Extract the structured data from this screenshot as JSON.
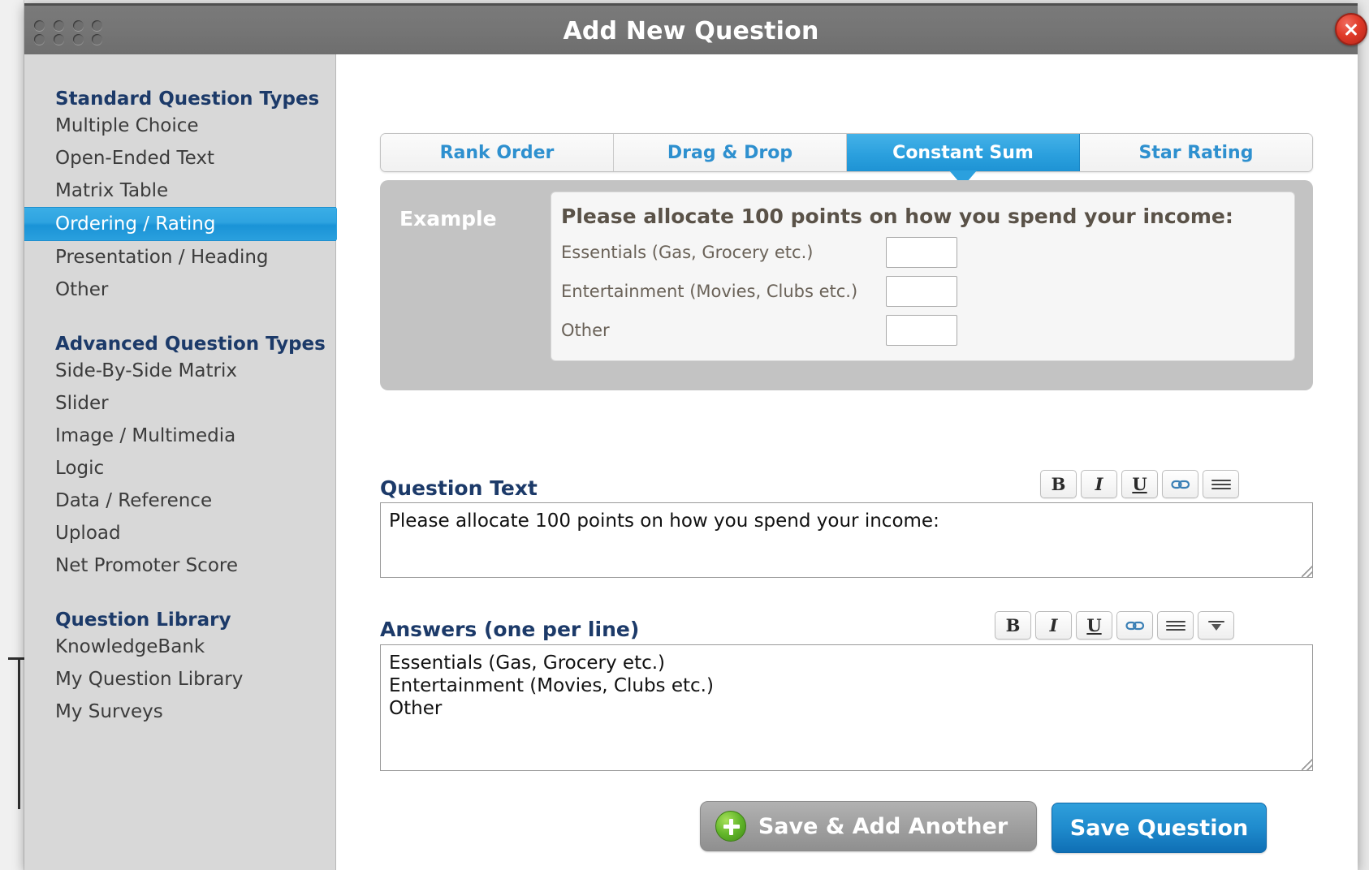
{
  "window": {
    "title": "Add New Question",
    "grip_icon": "drag-grip-dots",
    "close_icon": "close-icon"
  },
  "sidebar": {
    "sections": [
      {
        "title": "Standard Question Types",
        "items": [
          {
            "label": "Multiple Choice",
            "selected": false
          },
          {
            "label": "Open-Ended Text",
            "selected": false
          },
          {
            "label": "Matrix Table",
            "selected": false
          },
          {
            "label": "Ordering / Rating",
            "selected": true
          },
          {
            "label": "Presentation / Heading",
            "selected": false
          },
          {
            "label": "Other",
            "selected": false
          }
        ]
      },
      {
        "title": "Advanced Question Types",
        "items": [
          {
            "label": "Side-By-Side Matrix",
            "selected": false
          },
          {
            "label": "Slider",
            "selected": false
          },
          {
            "label": "Image / Multimedia",
            "selected": false
          },
          {
            "label": "Logic",
            "selected": false
          },
          {
            "label": "Data / Reference",
            "selected": false
          },
          {
            "label": "Upload",
            "selected": false
          },
          {
            "label": "Net Promoter Score",
            "selected": false
          }
        ]
      },
      {
        "title": "Question Library",
        "items": [
          {
            "label": "KnowledgeBank",
            "selected": false
          },
          {
            "label": "My Question Library",
            "selected": false
          },
          {
            "label": "My Surveys",
            "selected": false
          }
        ]
      }
    ]
  },
  "main": {
    "tabs": [
      {
        "label": "Rank Order",
        "active": false
      },
      {
        "label": "Drag & Drop",
        "active": false
      },
      {
        "label": "Constant Sum",
        "active": true
      },
      {
        "label": "Star Rating",
        "active": false
      }
    ],
    "example": {
      "label": "Example",
      "question": "Please allocate 100 points on how you spend your income:",
      "rows": [
        {
          "label": "Essentials (Gas, Grocery etc.)",
          "value": ""
        },
        {
          "label": "Entertainment (Movies, Clubs etc.)",
          "value": ""
        },
        {
          "label": "Other",
          "value": ""
        }
      ]
    },
    "question_text": {
      "label": "Question Text",
      "value": "Please allocate 100 points on how you spend your income:",
      "toolbar": [
        {
          "icon": "bold-icon",
          "glyph": "B",
          "style": "b"
        },
        {
          "icon": "italic-icon",
          "glyph": "I",
          "style": "i"
        },
        {
          "icon": "underline-icon",
          "glyph": "U",
          "style": "u"
        },
        {
          "icon": "link-icon",
          "glyph": "ὑ7",
          "style": "link"
        },
        {
          "icon": "align-lines-icon",
          "glyph": "≡",
          "style": "lines"
        }
      ]
    },
    "answers": {
      "label": "Answers (one per line)",
      "value": "Essentials (Gas, Grocery etc.)\nEntertainment (Movies, Clubs etc.)\nOther",
      "toolbar": [
        {
          "icon": "bold-icon",
          "glyph": "B",
          "style": "b"
        },
        {
          "icon": "italic-icon",
          "glyph": "I",
          "style": "i"
        },
        {
          "icon": "underline-icon",
          "glyph": "U",
          "style": "u"
        },
        {
          "icon": "link-icon",
          "glyph": "ὑ7",
          "style": "link"
        },
        {
          "icon": "align-lines-icon",
          "glyph": "≡",
          "style": "lines"
        },
        {
          "icon": "chevron-down-icon",
          "glyph": "▼",
          "style": "dropdown"
        }
      ]
    },
    "buttons": {
      "save_add_another": "Save & Add Another",
      "save_add_another_icon": "plus-circle-icon",
      "save_question": "Save Question"
    }
  },
  "colors": {
    "accent_blue": "#2ba0de",
    "heading_navy": "#1c3a69",
    "titlebar_gray": "#757575",
    "close_red": "#e03a28",
    "plus_green": "#62b62a",
    "save_blue": "#1f8bcd"
  }
}
